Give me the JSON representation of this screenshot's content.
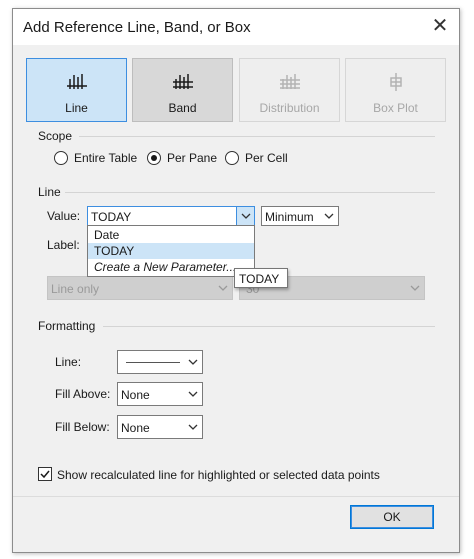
{
  "window": {
    "title": "Add Reference Line, Band, or Box",
    "close_glyph": "✕"
  },
  "types": [
    {
      "label": "Line",
      "state": "active",
      "icon": "line-chart-icon"
    },
    {
      "label": "Band",
      "state": "pressed",
      "icon": "band-chart-icon"
    },
    {
      "label": "Distribution",
      "state": "disabled",
      "icon": "distribution-chart-icon"
    },
    {
      "label": "Box Plot",
      "state": "disabled",
      "icon": "box-plot-icon"
    }
  ],
  "scope": {
    "title": "Scope",
    "options": [
      {
        "label": "Entire Table",
        "checked": false
      },
      {
        "label": "Per Pane",
        "checked": true
      },
      {
        "label": "Per Cell",
        "checked": false
      }
    ]
  },
  "line": {
    "title": "Line",
    "value_label": "Value:",
    "value_selected": "TODAY",
    "aggregation": "Minimum",
    "label_label": "Label:",
    "dropdown_items": [
      {
        "label": "Date",
        "selected": false,
        "italic": false
      },
      {
        "label": "TODAY",
        "selected": true,
        "italic": false
      },
      {
        "label": "Create a New Parameter...",
        "selected": false,
        "italic": true
      }
    ],
    "tooltip": "TODAY",
    "label_type": "Line only",
    "label_format": "",
    "label_format_partial": "30"
  },
  "formatting": {
    "title": "Formatting",
    "line_label": "Line:",
    "fill_above_label": "Fill Above:",
    "fill_above_value": "None",
    "fill_below_label": "Fill Below:",
    "fill_below_value": "None"
  },
  "recalc": {
    "label": "Show recalculated line for highlighted or selected data points",
    "checked": true
  },
  "ok_label": "OK",
  "colors": {
    "accent": "#3d8ee0",
    "selected_bg": "#cce4f7",
    "dialog_bg": "#f0f0f0"
  }
}
